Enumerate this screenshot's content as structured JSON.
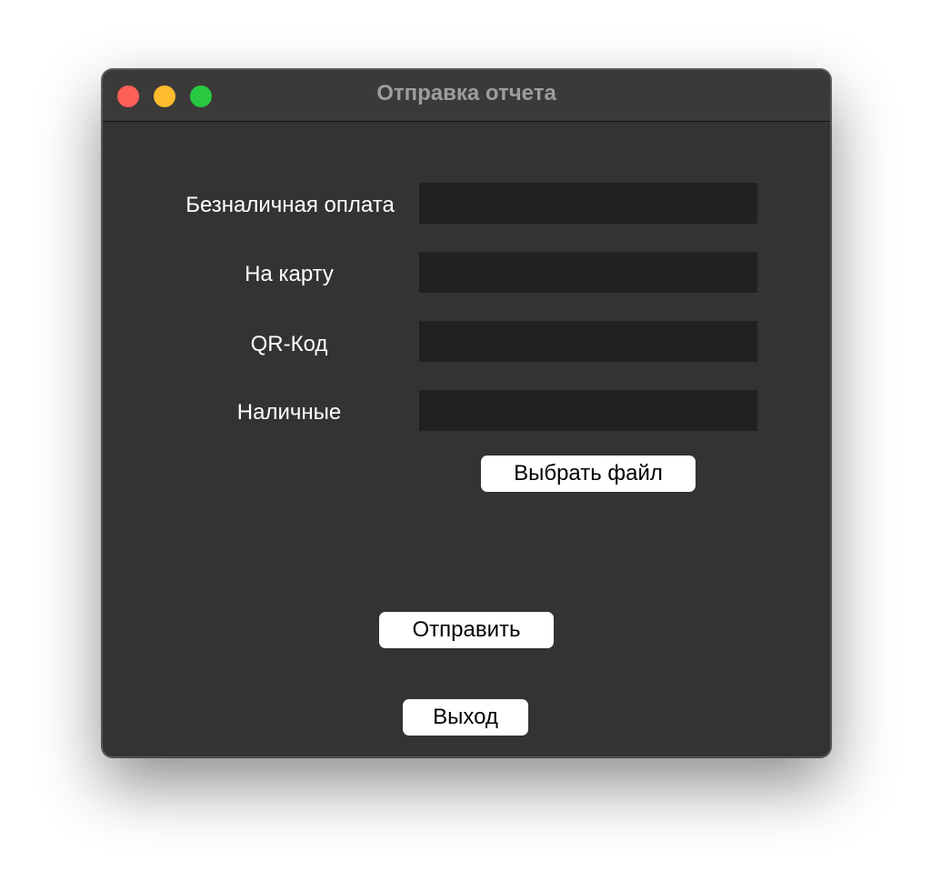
{
  "window": {
    "title": "Отправка отчета"
  },
  "form": {
    "fields": [
      {
        "label": "Безналичная оплата",
        "value": ""
      },
      {
        "label": "На карту",
        "value": ""
      },
      {
        "label": "QR-Код",
        "value": ""
      },
      {
        "label": "Наличные",
        "value": ""
      }
    ]
  },
  "buttons": {
    "choose_file": "Выбрать файл",
    "send": "Отправить",
    "exit": "Выход"
  },
  "colors": {
    "window_bg": "#333333",
    "titlebar_bg": "#3b3a39",
    "field_bg": "#212121",
    "close": "#fe5f57",
    "minimize": "#febc2e",
    "maximize": "#28c840"
  }
}
